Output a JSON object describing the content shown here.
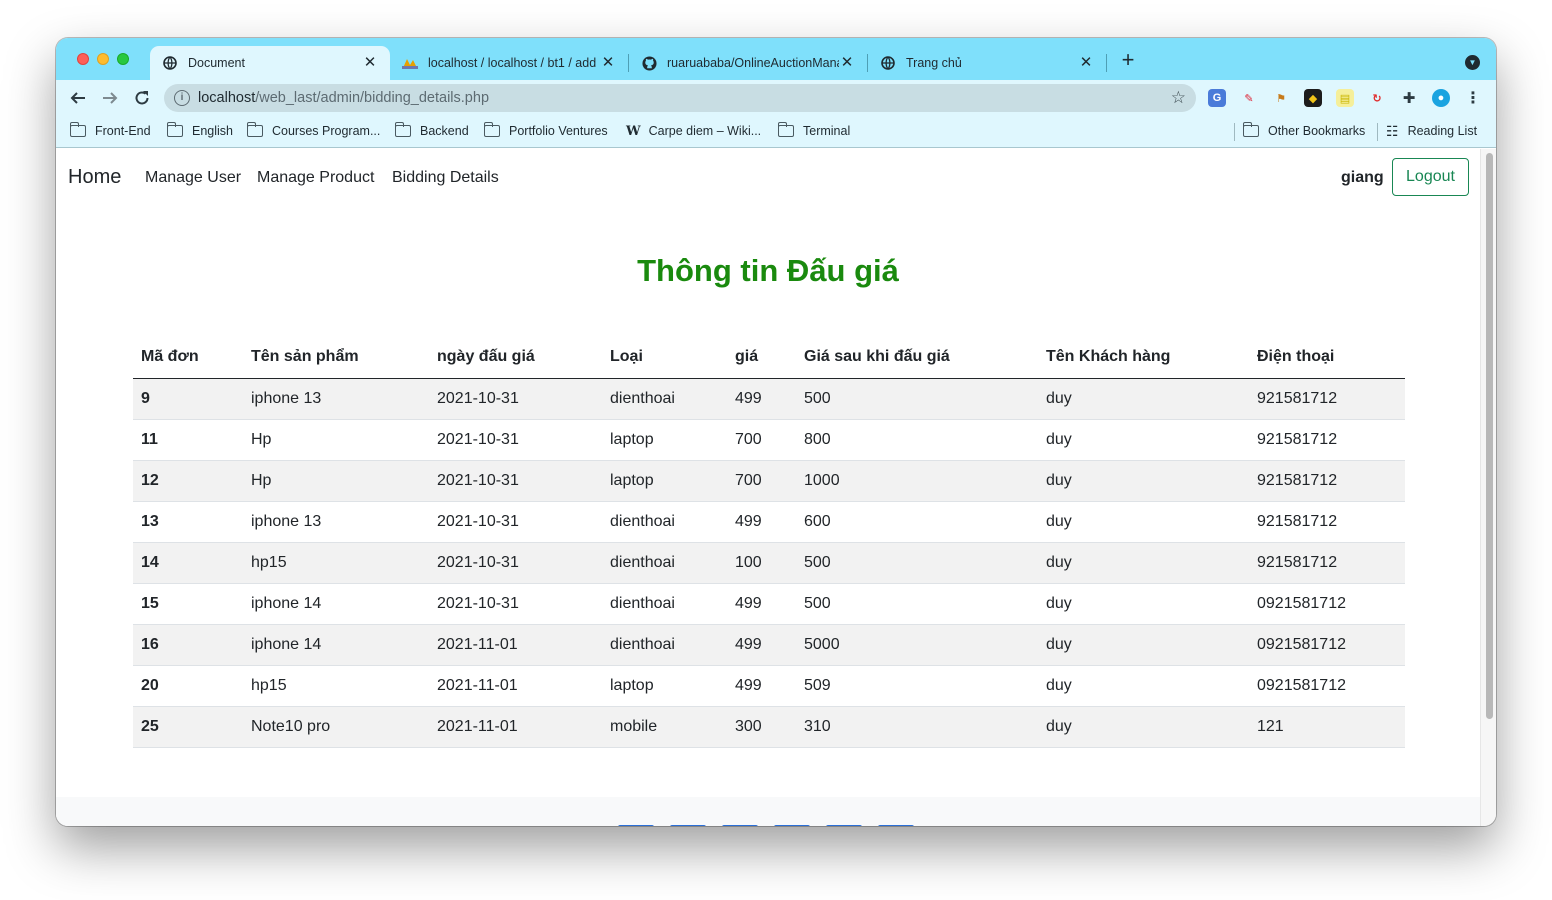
{
  "browser": {
    "tabs": [
      {
        "title": "Document",
        "active": true
      },
      {
        "title": "localhost / localhost / bt1 / add",
        "active": false
      },
      {
        "title": "ruaruababa/OnlineAuctionMana",
        "active": false
      },
      {
        "title": "Trang chủ",
        "active": false
      }
    ],
    "url": {
      "host": "localhost",
      "path": "/web_last/admin/bidding_details.php"
    },
    "bookmarks": [
      "Front-End",
      "English",
      "Courses Program...",
      "Backend",
      "Portfolio Ventures",
      "Carpe diem – Wiki...",
      "Terminal"
    ],
    "other_bookmarks": "Other Bookmarks",
    "reading_list": "Reading List"
  },
  "navbar": {
    "brand": "Home",
    "links": [
      "Manage User",
      "Manage Product",
      "Bidding Details"
    ],
    "username": "giang",
    "logout": "Logout"
  },
  "page": {
    "title": "Thông tin Đấu giá"
  },
  "table": {
    "headers": [
      "Mã đơn",
      "Tên sản phẩm",
      "ngày đấu giá",
      "Loại",
      "giá",
      "Giá sau khi đấu giá",
      "Tên Khách hàng",
      "Điện thoại"
    ],
    "rows": [
      [
        "9",
        "iphone 13",
        "2021-10-31",
        "dienthoai",
        "499",
        "500",
        "duy",
        "921581712"
      ],
      [
        "11",
        "Hp",
        "2021-10-31",
        "laptop",
        "700",
        "800",
        "duy",
        "921581712"
      ],
      [
        "12",
        "Hp",
        "2021-10-31",
        "laptop",
        "700",
        "1000",
        "duy",
        "921581712"
      ],
      [
        "13",
        "iphone 13",
        "2021-10-31",
        "dienthoai",
        "499",
        "600",
        "duy",
        "921581712"
      ],
      [
        "14",
        "hp15",
        "2021-10-31",
        "dienthoai",
        "100",
        "500",
        "duy",
        "921581712"
      ],
      [
        "15",
        "iphone 14",
        "2021-10-31",
        "dienthoai",
        "499",
        "500",
        "duy",
        "0921581712"
      ],
      [
        "16",
        "iphone 14",
        "2021-11-01",
        "dienthoai",
        "499",
        "5000",
        "duy",
        "0921581712"
      ],
      [
        "20",
        "hp15",
        "2021-11-01",
        "laptop",
        "499",
        "509",
        "duy",
        "0921581712"
      ],
      [
        "25",
        "Note10 pro",
        "2021-11-01",
        "mobile",
        "300",
        "310",
        "duy",
        "121"
      ]
    ]
  },
  "colors": {
    "accent_green": "#1a8a0e",
    "tabstrip": "#7fe0fb",
    "logout_border": "#198754"
  }
}
